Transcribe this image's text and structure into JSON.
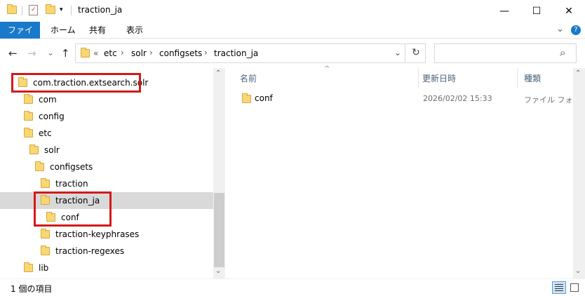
{
  "window": {
    "title": "traction_ja",
    "minimize_glyph": "—",
    "maximize_glyph": "☐",
    "close_glyph": "✕"
  },
  "ribbon": {
    "tabs": [
      "ファイル",
      "ホーム",
      "共有",
      "表示"
    ],
    "expand_glyph": "⌄",
    "help_glyph": "?"
  },
  "nav": {
    "back_glyph": "←",
    "forward_glyph": "→",
    "recent_glyph": "⌄",
    "up_glyph": "↑",
    "overflow_glyph": "«",
    "breadcrumb": [
      "etc",
      "solr",
      "configsets",
      "traction_ja"
    ],
    "separator": "›",
    "dropdown_glyph": "⌄",
    "refresh_glyph": "↻",
    "search_placeholder": "",
    "search_glyph": "⌕"
  },
  "tree": [
    {
      "label": "com.traction.extsearch.solr",
      "indent": 0,
      "highlighted": true
    },
    {
      "label": "com",
      "indent": 1
    },
    {
      "label": "config",
      "indent": 1
    },
    {
      "label": "etc",
      "indent": 1
    },
    {
      "label": "solr",
      "indent": 2
    },
    {
      "label": "configsets",
      "indent": 3
    },
    {
      "label": "traction",
      "indent": 4
    },
    {
      "label": "traction_ja",
      "indent": 4,
      "selected": true,
      "highlighted": true
    },
    {
      "label": "conf",
      "indent": 5,
      "highlighted": true
    },
    {
      "label": "traction-keyphrases",
      "indent": 4
    },
    {
      "label": "traction-regexes",
      "indent": 4
    },
    {
      "label": "lib",
      "indent": 1
    }
  ],
  "columns": {
    "name": "名前",
    "modified": "更新日時",
    "type": "種類",
    "sort_glyph": "^"
  },
  "files": [
    {
      "name": "conf",
      "modified": "2026/02/02 15:33",
      "type": "ファイル フォルダー"
    }
  ],
  "status": {
    "count_text": "1 個の項目"
  },
  "scroll": {
    "up_glyph": "⌃",
    "down_glyph": "⌄"
  },
  "colors": {
    "file_tab": "#1979ca",
    "folder": "#f8d775",
    "highlight_box": "#d31a1a",
    "selected_row": "#d9d9d9"
  }
}
